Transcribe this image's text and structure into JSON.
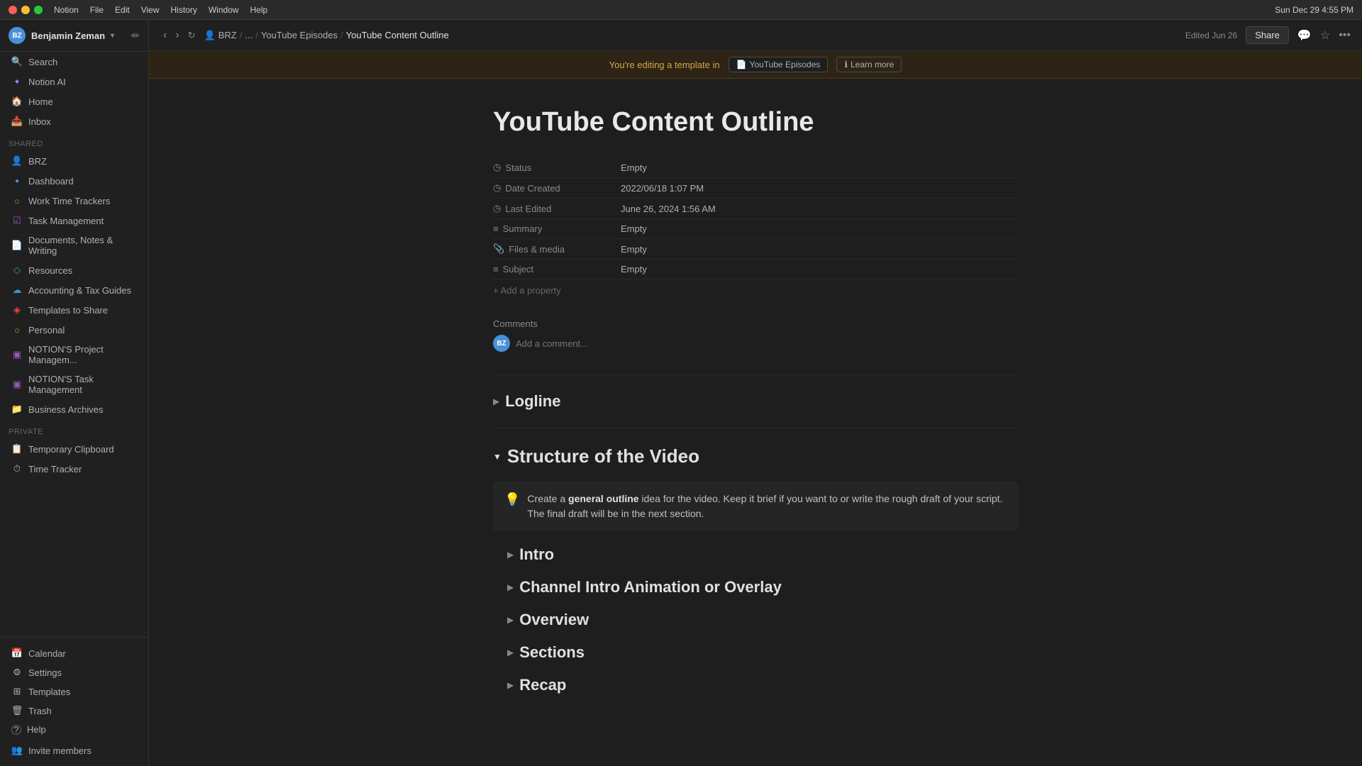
{
  "mac": {
    "app_name": "Notion",
    "menu": [
      "Notion",
      "File",
      "Edit",
      "View",
      "History",
      "Window",
      "Help"
    ],
    "datetime": "Sun Dec 29  4:55 PM"
  },
  "topbar": {
    "breadcrumb": {
      "workspace": "BRZ",
      "sep1": "...",
      "parent": "YouTube Episodes",
      "sep2": "/",
      "current": "YouTube Content Outline"
    },
    "edited_label": "Edited Jun 26",
    "share_label": "Share"
  },
  "banner": {
    "text": "You're editing a template in",
    "template_link": "YouTube Episodes",
    "learn_more": "Learn more"
  },
  "sidebar": {
    "user": {
      "name": "Benjamin Zeman",
      "initials": "BZ"
    },
    "items": [
      {
        "id": "search",
        "icon": "🔍",
        "label": "Search"
      },
      {
        "id": "notion-ai",
        "icon": "✦",
        "label": "Notion AI"
      },
      {
        "id": "home",
        "icon": "🏠",
        "label": "Home"
      },
      {
        "id": "inbox",
        "icon": "📥",
        "label": "Inbox"
      }
    ],
    "shared_section": "Shared",
    "shared_items": [
      {
        "id": "brz",
        "icon": "👤",
        "label": "BRZ"
      },
      {
        "id": "dashboard",
        "icon": "●",
        "label": "Dashboard"
      },
      {
        "id": "work-time",
        "icon": "○",
        "label": "Work Time Trackers"
      },
      {
        "id": "task-mgmt",
        "icon": "☑",
        "label": "Task Management"
      },
      {
        "id": "documents",
        "icon": "📄",
        "label": "Documents, Notes & Writing"
      },
      {
        "id": "resources",
        "icon": "◇",
        "label": "Resources"
      },
      {
        "id": "accounting",
        "icon": "☁",
        "label": "Accounting & Tax Guides"
      },
      {
        "id": "templates-share",
        "icon": "◈",
        "label": "Templates to Share"
      },
      {
        "id": "personal",
        "icon": "○",
        "label": "Personal"
      },
      {
        "id": "notions-project",
        "icon": "▣",
        "label": "NOTION'S Project Managem..."
      },
      {
        "id": "notions-task",
        "icon": "▣",
        "label": "NOTION'S Task Management"
      },
      {
        "id": "business",
        "icon": "📁",
        "label": "Business Archives"
      }
    ],
    "private_section": "Private",
    "private_items": [
      {
        "id": "temp-clipboard",
        "icon": "📋",
        "label": "Temporary Clipboard"
      },
      {
        "id": "time-tracker",
        "icon": "⏱",
        "label": "Time Tracker"
      }
    ],
    "bottom_items": [
      {
        "id": "calendar",
        "icon": "📅",
        "label": "Calendar"
      },
      {
        "id": "settings",
        "icon": "⚙",
        "label": "Settings"
      },
      {
        "id": "templates",
        "icon": "⊞",
        "label": "Templates"
      },
      {
        "id": "trash",
        "icon": "🗑",
        "label": "Trash"
      },
      {
        "id": "help",
        "icon": "?",
        "label": "Help"
      }
    ],
    "invite_members": "Invite members"
  },
  "page": {
    "title": "YouTube Content Outline",
    "properties": [
      {
        "icon": "◷",
        "label": "Status",
        "value": "Empty"
      },
      {
        "icon": "◷",
        "label": "Date Created",
        "value": "2022/06/18 1:07 PM"
      },
      {
        "icon": "◷",
        "label": "Last Edited",
        "value": "June 26, 2024 1:56 AM"
      },
      {
        "icon": "≡",
        "label": "Summary",
        "value": "Empty"
      },
      {
        "icon": "📎",
        "label": "Files & media",
        "value": "Empty"
      },
      {
        "icon": "≡",
        "label": "Subject",
        "value": "Empty"
      }
    ],
    "add_property": "+ Add a property",
    "comments_label": "Comments",
    "comment_placeholder": "Add a comment...",
    "sections": [
      {
        "id": "logline",
        "title": "Logline",
        "level": "h2",
        "collapsed": true
      },
      {
        "id": "structure",
        "title": "Structure of the Video",
        "level": "h1",
        "collapsed": false,
        "callout": {
          "icon": "💡",
          "text_before": "Create a ",
          "bold": "general outline",
          "text_after": " idea for the video. Keep it brief if you want to or write the rough draft of your script. The final draft will be in the next section."
        },
        "subsections": [
          {
            "id": "intro",
            "title": "Intro"
          },
          {
            "id": "channel-intro",
            "title": "Channel Intro Animation or Overlay"
          },
          {
            "id": "overview",
            "title": "Overview"
          },
          {
            "id": "sections",
            "title": "Sections"
          },
          {
            "id": "recap",
            "title": "Recap"
          }
        ]
      }
    ]
  }
}
